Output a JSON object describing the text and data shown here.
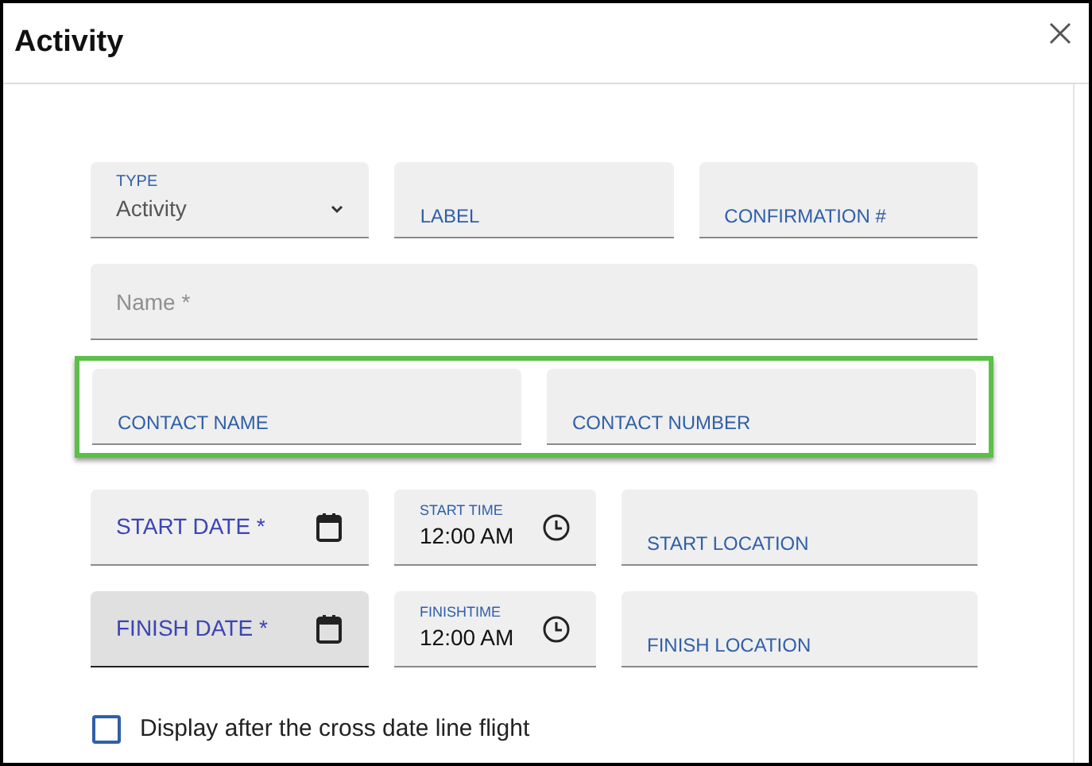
{
  "dialog": {
    "title": "Activity"
  },
  "rows": [
    {
      "highlighted": false,
      "fields": [
        {
          "kind": "select",
          "label": "TYPE",
          "value": "Activity"
        },
        {
          "kind": "text",
          "label": "LABEL"
        },
        {
          "kind": "text",
          "label": "CONFIRMATION #"
        }
      ]
    },
    {
      "highlighted": false,
      "fields": [
        {
          "kind": "input",
          "placeholder": "Name *"
        }
      ]
    },
    {
      "highlighted": true,
      "fields": [
        {
          "kind": "text",
          "label": "CONTACT NAME"
        },
        {
          "kind": "text",
          "label": "CONTACT NUMBER"
        }
      ]
    },
    {
      "highlighted": false,
      "fields": [
        {
          "kind": "date",
          "label": "START DATE *",
          "hovered": false
        },
        {
          "kind": "time",
          "label": "START TIME",
          "value": "12:00 AM"
        },
        {
          "kind": "text",
          "label": "START LOCATION"
        }
      ]
    },
    {
      "highlighted": false,
      "fields": [
        {
          "kind": "date",
          "label": "FINISH DATE *",
          "hovered": true
        },
        {
          "kind": "time",
          "label": "FINISHTIME",
          "value": "12:00 AM"
        },
        {
          "kind": "text",
          "label": "FINISH LOCATION"
        }
      ]
    }
  ],
  "checkbox": {
    "label": "Display after the cross date line flight",
    "checked": false
  }
}
